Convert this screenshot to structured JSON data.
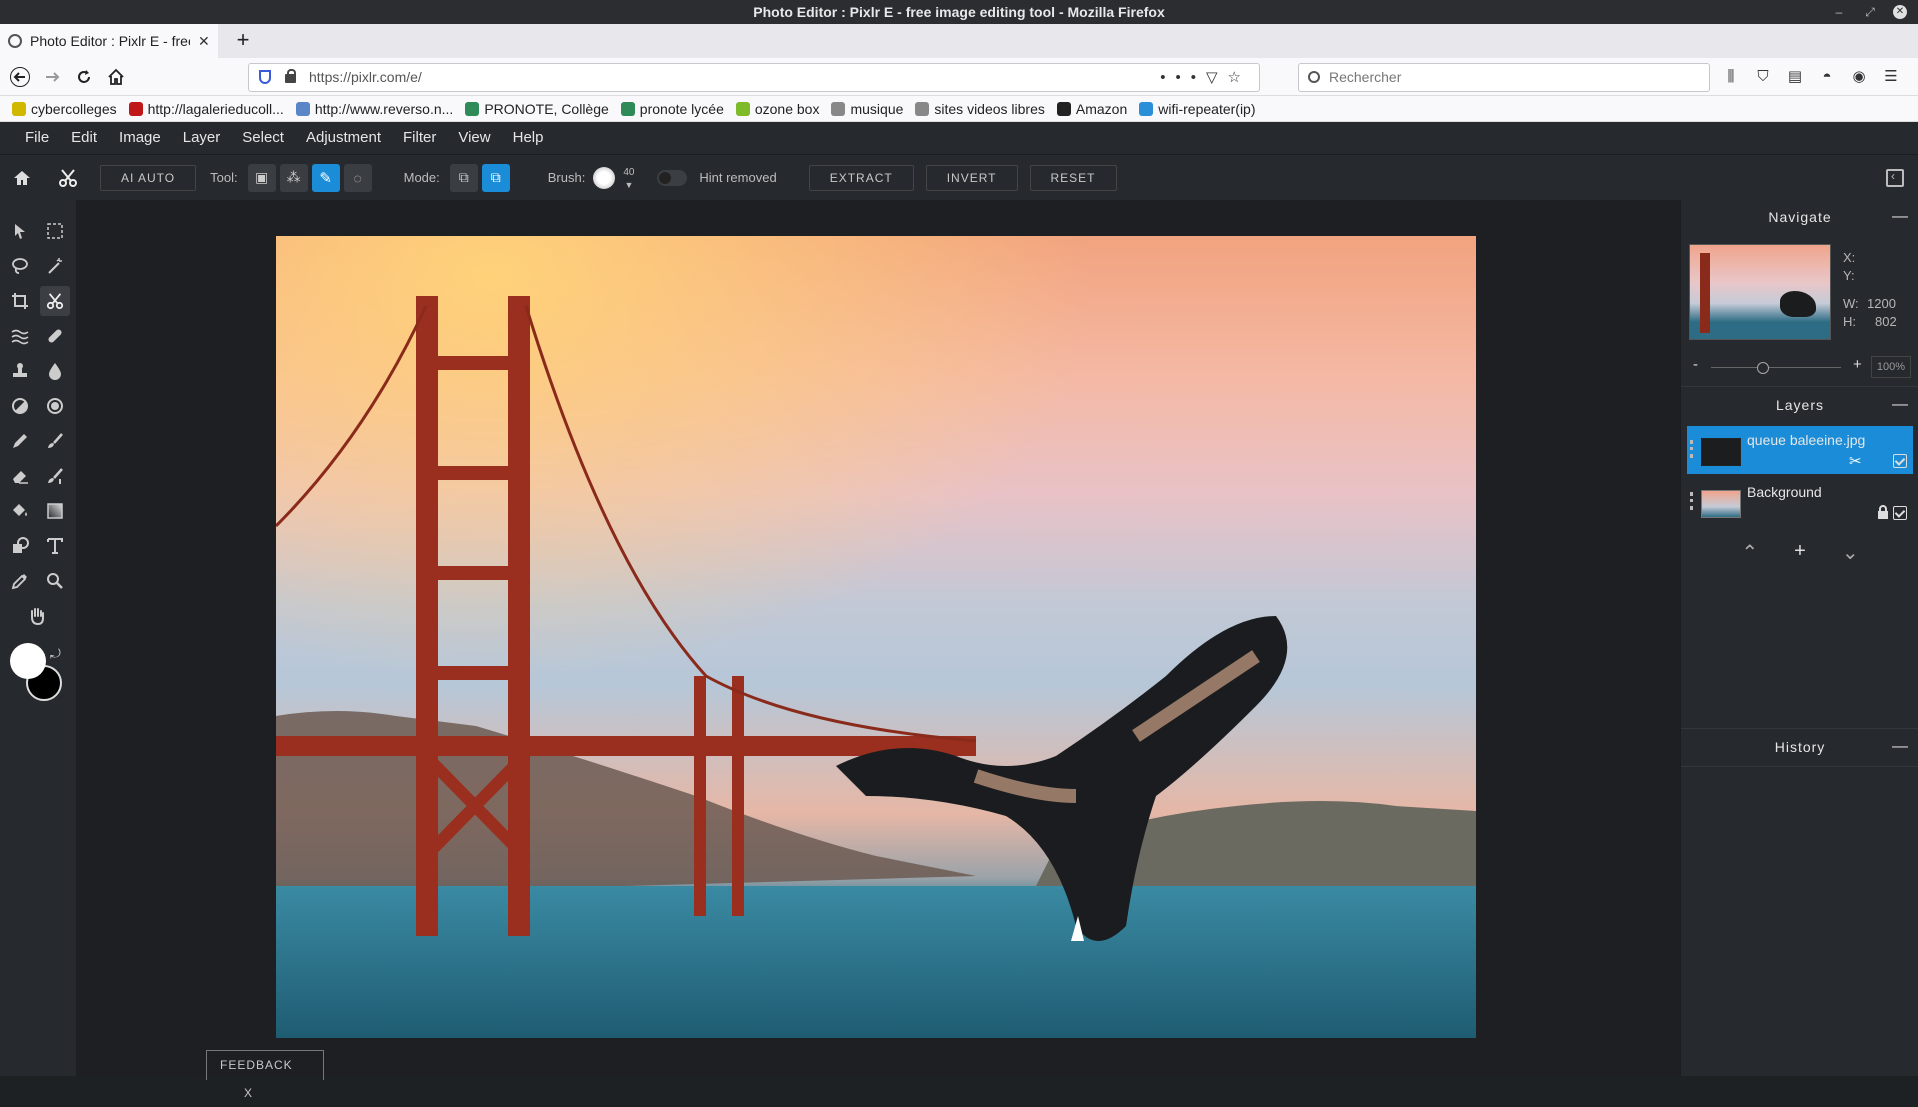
{
  "window": {
    "title": "Photo Editor : Pixlr E - free image editing tool - Mozilla Firefox"
  },
  "browser": {
    "tab_title": "Photo Editor : Pixlr E - free image editing tool",
    "url": "https://pixlr.com/e/",
    "search_placeholder": "Rechercher",
    "bookmarks": [
      {
        "label": "cybercolleges",
        "color": "#d0b800"
      },
      {
        "label": "http://lagalerieducoll...",
        "color": "#c01818"
      },
      {
        "label": "http://www.reverso.n...",
        "color": "#5a86c8"
      },
      {
        "label": "PRONOTE, Collège",
        "color": "#2e8b57"
      },
      {
        "label": "pronote lycée",
        "color": "#2e8b57"
      },
      {
        "label": "ozone box",
        "color": "#7dbb2a"
      },
      {
        "label": "musique",
        "color": "#888888"
      },
      {
        "label": "sites videos libres",
        "color": "#888888"
      },
      {
        "label": "Amazon",
        "color": "#222222"
      },
      {
        "label": "wifi-repeater(ip)",
        "color": "#2a8fd8"
      }
    ]
  },
  "menu": [
    "File",
    "Edit",
    "Image",
    "Layer",
    "Select",
    "Adjustment",
    "Filter",
    "View",
    "Help"
  ],
  "options": {
    "ai_auto": "AI AUTO",
    "tool_label": "Tool:",
    "mode_label": "Mode:",
    "brush_label": "Brush:",
    "brush_size": "40",
    "hint": "Hint removed",
    "extract": "EXTRACT",
    "invert": "INVERT",
    "reset": "RESET"
  },
  "navigate": {
    "title": "Navigate",
    "x_label": "X:",
    "y_label": "Y:",
    "w_label": "W:",
    "w_value": "1200",
    "h_label": "H:",
    "h_value": "802",
    "zoom_minus": "-",
    "zoom_plus": "+",
    "zoom": "100%",
    "zoom_level": 0.4
  },
  "layers": {
    "title": "Layers",
    "items": [
      {
        "name": "queue baleeine.jpg",
        "selected": true
      },
      {
        "name": "Background",
        "selected": false
      }
    ]
  },
  "history": {
    "title": "History"
  },
  "feedback": {
    "label": "FEEDBACK",
    "close": "X"
  },
  "accent_color": "#1b8dd8"
}
